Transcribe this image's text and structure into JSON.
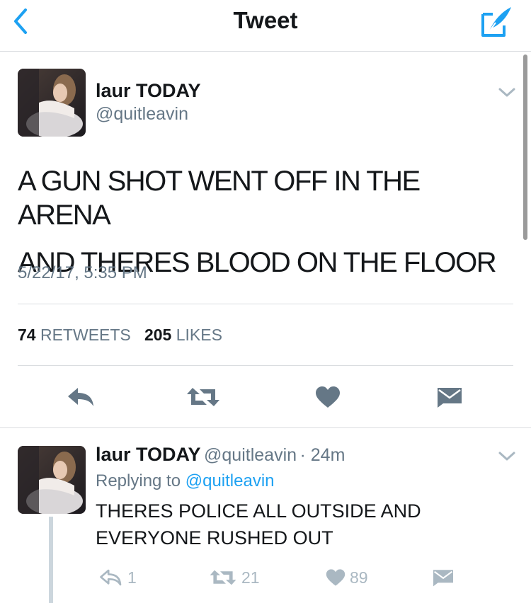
{
  "nav": {
    "title": "Tweet",
    "back_icon": "chevron-left-icon",
    "compose_icon": "compose-quill-icon"
  },
  "colors": {
    "accent": "#1da1f2",
    "secondary_text": "#657786",
    "icon_gray": "#657786",
    "icon_light": "#aab8c2"
  },
  "main_tweet": {
    "display_name": "laur TODAY",
    "handle": "@quitleavin",
    "text_line1": "A GUN SHOT WENT OFF IN THE ARENA",
    "text_line2": "AND THERES BLOOD ON THE FLOOR",
    "timestamp": "5/22/17, 5:35 PM",
    "retweets_count": "74",
    "retweets_label": "RETWEETS",
    "likes_count": "205",
    "likes_label": "LIKES",
    "actions": [
      "reply-icon",
      "retweet-icon",
      "heart-icon",
      "dm-envelope-icon"
    ]
  },
  "reply_tweet": {
    "display_name": "laur TODAY",
    "handle": "@quitleavin",
    "time": "· 24m",
    "replying_prefix": "Replying to",
    "replying_handle": "@quitleavin",
    "text_line1": "THERES POLICE ALL OUTSIDE AND",
    "text_line2": "EVERYONE RUSHED OUT",
    "reply_count": "1",
    "retweet_count": "21",
    "like_count": "89"
  }
}
